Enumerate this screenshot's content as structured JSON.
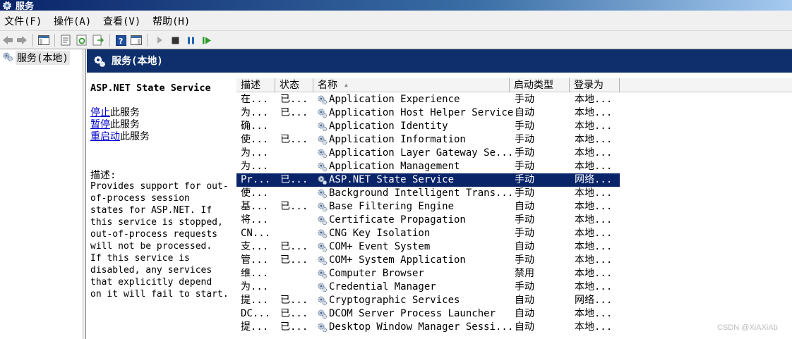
{
  "window": {
    "title": "服务",
    "icon": "gear-icon"
  },
  "menu": [
    {
      "label": "文件(F)"
    },
    {
      "label": "操作(A)"
    },
    {
      "label": "查看(V)"
    },
    {
      "label": "帮助(H)"
    }
  ],
  "toolbar": {
    "buttons": [
      "back-arrow-icon",
      "forward-arrow-icon",
      "show-hide-console-tree-icon",
      "properties-icon",
      "refresh-icon",
      "export-list-icon",
      "help-icon",
      "action-pane-icon",
      "start-service-icon",
      "stop-service-icon",
      "pause-service-icon",
      "restart-service-icon"
    ]
  },
  "tree": {
    "item_label": "服务(本地)"
  },
  "pane": {
    "header_title": "服务(本地)"
  },
  "detail": {
    "service_name": "ASP.NET State Service",
    "actions": [
      {
        "link": "停止",
        "rest": "此服务"
      },
      {
        "link": "暂停",
        "rest": "此服务"
      },
      {
        "link": "重启动",
        "rest": "此服务"
      }
    ],
    "description_label": "描述:",
    "description_text": "Provides support for out-\nof-process session\nstates for ASP.NET. If\nthis service is stopped,\nout-of-process requests\nwill not be processed.\nIf this service is\ndisabled, any services\nthat explicitly depend\non it will fail to start."
  },
  "table": {
    "columns": [
      "描述",
      "状态",
      "名称",
      "启动类型",
      "登录为"
    ],
    "sorted_column": "名称",
    "rows": [
      {
        "desc": "在...",
        "status": "已...",
        "name": "Application Experience",
        "startup": "手动",
        "logon": "本地..."
      },
      {
        "desc": "为...",
        "status": "已...",
        "name": "Application Host Helper Service",
        "startup": "自动",
        "logon": "本地..."
      },
      {
        "desc": "确...",
        "status": "",
        "name": "Application Identity",
        "startup": "手动",
        "logon": "本地..."
      },
      {
        "desc": "使...",
        "status": "已...",
        "name": "Application Information",
        "startup": "手动",
        "logon": "本地..."
      },
      {
        "desc": "为...",
        "status": "",
        "name": "Application Layer Gateway Se...",
        "startup": "手动",
        "logon": "本地..."
      },
      {
        "desc": "为...",
        "status": "",
        "name": "Application Management",
        "startup": "手动",
        "logon": "本地..."
      },
      {
        "desc": "Pr...",
        "status": "已...",
        "name": "ASP.NET State Service",
        "startup": "手动",
        "logon": "网络...",
        "selected": true
      },
      {
        "desc": "使...",
        "status": "",
        "name": "Background Intelligent Trans...",
        "startup": "手动",
        "logon": "本地..."
      },
      {
        "desc": "基...",
        "status": "已...",
        "name": "Base Filtering Engine",
        "startup": "自动",
        "logon": "本地..."
      },
      {
        "desc": "将...",
        "status": "",
        "name": "Certificate Propagation",
        "startup": "手动",
        "logon": "本地..."
      },
      {
        "desc": "CN...",
        "status": "",
        "name": "CNG Key Isolation",
        "startup": "手动",
        "logon": "本地..."
      },
      {
        "desc": "支...",
        "status": "已...",
        "name": "COM+ Event System",
        "startup": "自动",
        "logon": "本地..."
      },
      {
        "desc": "管...",
        "status": "已...",
        "name": "COM+ System Application",
        "startup": "手动",
        "logon": "本地..."
      },
      {
        "desc": "维...",
        "status": "",
        "name": "Computer Browser",
        "startup": "禁用",
        "logon": "本地..."
      },
      {
        "desc": "为...",
        "status": "",
        "name": "Credential Manager",
        "startup": "手动",
        "logon": "本地..."
      },
      {
        "desc": "提...",
        "status": "已...",
        "name": "Cryptographic Services",
        "startup": "自动",
        "logon": "网络..."
      },
      {
        "desc": "DC...",
        "status": "已...",
        "name": "DCOM Server Process Launcher",
        "startup": "自动",
        "logon": "本地..."
      },
      {
        "desc": "提...",
        "status": "已...",
        "name": "Desktop Window Manager Sessi...",
        "startup": "自动",
        "logon": "本地..."
      }
    ]
  },
  "watermark": "CSDN @XiAXiAb",
  "colors": {
    "selection": "#0a246a",
    "header_band": "#0f2f6c",
    "link": "#0000cc"
  }
}
